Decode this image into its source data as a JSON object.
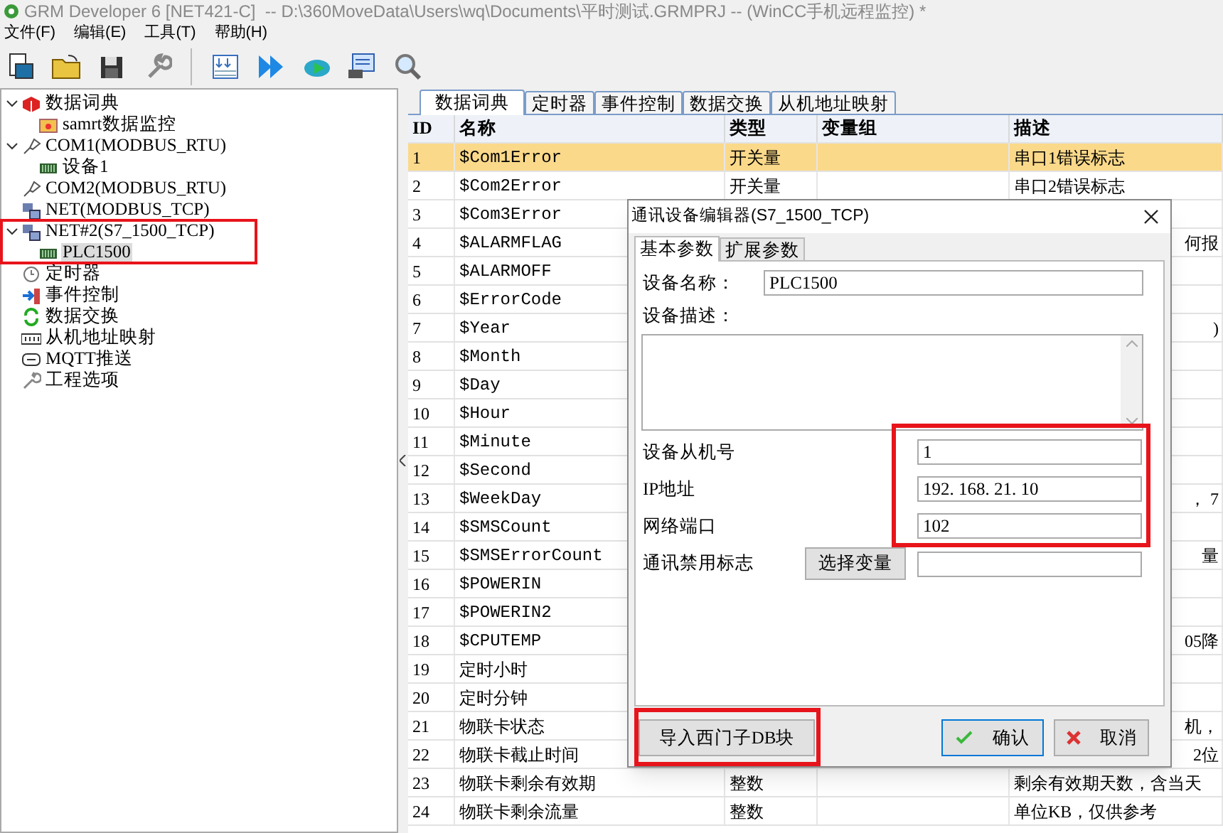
{
  "window": {
    "title": "GRM Developer 6 [NET421-C]  -- D:\\360MoveData\\Users\\wq\\Documents\\平时测试.GRMPRJ -- (WinCC手机远程监控) *"
  },
  "menu": [
    "文件(F)",
    "编辑(E)",
    "工具(T)",
    "帮助(H)"
  ],
  "tree": [
    {
      "label": "数据词典",
      "kind": "dictionary",
      "selected": false,
      "expanded": true,
      "children": [
        {
          "label": "samrt数据监控",
          "kind": "monitor",
          "selected": false
        }
      ]
    },
    {
      "label": "COM1(MODBUS_RTU)",
      "kind": "serial",
      "selected": false,
      "expanded": true,
      "children": [
        {
          "label": "设备1",
          "kind": "device",
          "selected": false
        }
      ]
    },
    {
      "label": "COM2(MODBUS_RTU)",
      "kind": "serial",
      "selected": false
    },
    {
      "label": "NET(MODBUS_TCP)",
      "kind": "network",
      "selected": false
    },
    {
      "label": "NET#2(S7_1500_TCP)",
      "kind": "network",
      "selected": false,
      "expanded": true,
      "children": [
        {
          "label": "PLC1500",
          "kind": "device",
          "selected": true
        }
      ]
    },
    {
      "label": "定时器",
      "kind": "timer",
      "selected": false
    },
    {
      "label": "事件控制",
      "kind": "event",
      "selected": false
    },
    {
      "label": "数据交换",
      "kind": "exchange",
      "selected": false
    },
    {
      "label": "从机地址映射",
      "kind": "mapping",
      "selected": false
    },
    {
      "label": "MQTT推送",
      "kind": "mqtt",
      "selected": false
    },
    {
      "label": "工程选项",
      "kind": "options",
      "selected": false
    }
  ],
  "tabs": [
    {
      "label": "数据词典",
      "selected": true
    },
    {
      "label": "定时器",
      "selected": false
    },
    {
      "label": "事件控制",
      "selected": false
    },
    {
      "label": "数据交换",
      "selected": false
    },
    {
      "label": "从机地址映射",
      "selected": false
    }
  ],
  "table": {
    "columns": [
      "ID",
      "名称",
      "类型",
      "变量组",
      "描述"
    ],
    "rows": [
      {
        "id": "1",
        "name": "$Com1Error",
        "type": "开关量",
        "description": "串口1错误标志",
        "selected": true
      },
      {
        "id": "2",
        "name": "$Com2Error",
        "type": "开关量",
        "description": "串口2错误标志",
        "selected": false
      },
      {
        "id": "3",
        "name": "$Com3Error",
        "selected": false
      },
      {
        "id": "4",
        "name": "$ALARMFLAG",
        "description": "何报",
        "selected": false
      },
      {
        "id": "5",
        "name": "$ALARMOFF",
        "selected": false
      },
      {
        "id": "6",
        "name": "$ErrorCode",
        "selected": false
      },
      {
        "id": "7",
        "name": "$Year",
        "description": ")",
        "selected": false
      },
      {
        "id": "8",
        "name": "$Month",
        "selected": false
      },
      {
        "id": "9",
        "name": "$Day",
        "selected": false
      },
      {
        "id": "10",
        "name": "$Hour",
        "selected": false
      },
      {
        "id": "11",
        "name": "$Minute",
        "selected": false
      },
      {
        "id": "12",
        "name": "$Second",
        "selected": false
      },
      {
        "id": "13",
        "name": "$WeekDay",
        "description": "， 7",
        "selected": false
      },
      {
        "id": "14",
        "name": "$SMSCount",
        "selected": false
      },
      {
        "id": "15",
        "name": "$SMSErrorCount",
        "description": "量",
        "selected": false
      },
      {
        "id": "16",
        "name": "$POWERIN",
        "selected": false
      },
      {
        "id": "17",
        "name": "$POWERIN2",
        "selected": false
      },
      {
        "id": "18",
        "name": "$CPUTEMP",
        "description": "05降",
        "selected": false
      },
      {
        "id": "19",
        "name": "定时小时",
        "selected": false
      },
      {
        "id": "20",
        "name": "定时分钟",
        "selected": false
      },
      {
        "id": "21",
        "name": "物联卡状态",
        "description": "机，",
        "selected": false
      },
      {
        "id": "22",
        "name": "物联卡截止时间",
        "description": "2位",
        "selected": false
      },
      {
        "id": "23",
        "name": "物联卡剩余有效期",
        "type": "整数",
        "description": "剩余有效期天数，含当天",
        "selected": false
      },
      {
        "id": "24",
        "name": "物联卡剩余流量",
        "type": "整数",
        "description": "单位KB，仅供参考",
        "selected": false
      }
    ]
  },
  "dialog": {
    "title": "通讯设备编辑器(S7_1500_TCP)",
    "tabs": [
      {
        "label": "基本参数",
        "selected": true
      },
      {
        "label": "扩展参数",
        "selected": false
      }
    ],
    "fields": [
      {
        "kind": "inline",
        "label": "设备名称：",
        "value": "PLC1500"
      },
      {
        "kind": "textarea",
        "label": "设备描述："
      },
      {
        "kind": "text",
        "label": "设备从机号",
        "value": "1"
      },
      {
        "kind": "text",
        "label": "IP地址",
        "value": "192. 168. 21. 10"
      },
      {
        "kind": "text",
        "label": "网络端口",
        "value": "102"
      },
      {
        "kind": "picker",
        "label": "通讯禁用标志",
        "button": "选择变量"
      }
    ],
    "buttons": [
      {
        "kind": "plain",
        "label": "导入西门子DB块",
        "focused": false
      },
      {
        "kind": "confirm",
        "label": "确认",
        "focused": true
      },
      {
        "kind": "cancel",
        "label": "取消",
        "focused": false
      }
    ]
  }
}
